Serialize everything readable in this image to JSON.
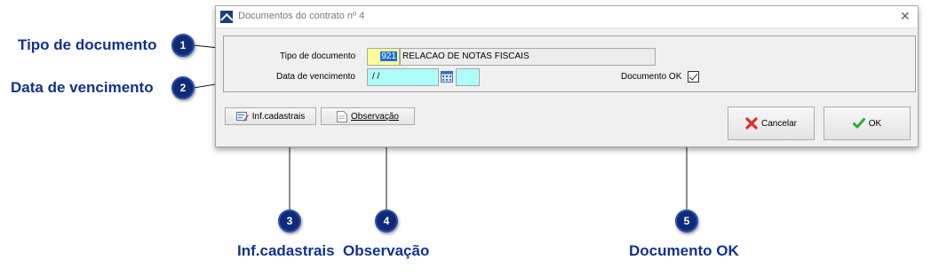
{
  "window": {
    "title": "Documentos do contrato nº 4",
    "close_symbol": "✕"
  },
  "form": {
    "tipo_label": "Tipo de documento",
    "tipo_code": "921",
    "tipo_description": "RELACAO DE NOTAS FISCAIS",
    "vencimento_label": "Data de vencimento",
    "vencimento_value": "/  /",
    "documento_ok_label": "Documento OK",
    "documento_ok_checked": true
  },
  "buttons": {
    "inf_cadastrais": "Inf.cadastrais",
    "observacao": "Observação",
    "cancelar": "Cancelar",
    "ok": "OK"
  },
  "callouts": [
    {
      "number": "1",
      "label": "Tipo de documento"
    },
    {
      "number": "2",
      "label": "Data de vencimento"
    },
    {
      "number": "3",
      "label": "Inf.cadastrais"
    },
    {
      "number": "4",
      "label": "Observação"
    },
    {
      "number": "5",
      "label": "Documento OK"
    }
  ],
  "icons": {
    "app": "app-logo-icon",
    "calendar": "calendar-icon",
    "inf": "edit-card-icon",
    "obs": "note-icon",
    "cancel": "red-x-icon",
    "ok": "green-check-icon"
  },
  "colors": {
    "callout": "#0e2a78",
    "code_field": "#ffff99",
    "date_field": "#aefffa"
  }
}
